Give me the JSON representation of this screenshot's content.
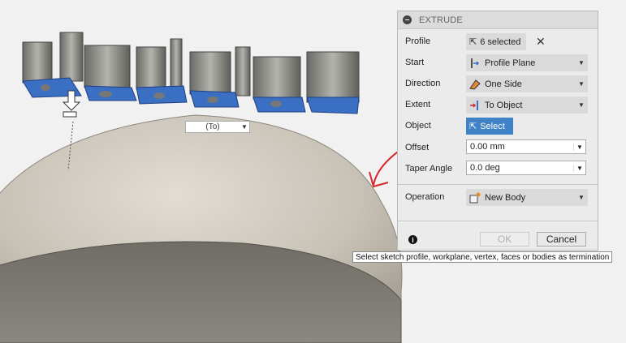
{
  "dialog": {
    "title": "EXTRUDE",
    "rows": {
      "profile": {
        "label": "Profile",
        "value": "6 selected"
      },
      "start": {
        "label": "Start",
        "value": "Profile Plane"
      },
      "direction": {
        "label": "Direction",
        "value": "One Side"
      },
      "extent": {
        "label": "Extent",
        "value": "To Object"
      },
      "object": {
        "label": "Object",
        "value": "Select"
      },
      "offset": {
        "label": "Offset",
        "value": "0.00 mm"
      },
      "taper": {
        "label": "Taper Angle",
        "value": "0.0 deg"
      },
      "operation": {
        "label": "Operation",
        "value": "New Body"
      }
    },
    "ok_label": "OK",
    "cancel_label": "Cancel",
    "info_glyph": "i"
  },
  "viewport": {
    "to_label": "(To)",
    "letters_color": "#3a6fc4",
    "annotation_color": "#d8262a"
  },
  "tooltip": "Select sketch profile, workplane, vertex, faces or bodies as termination"
}
